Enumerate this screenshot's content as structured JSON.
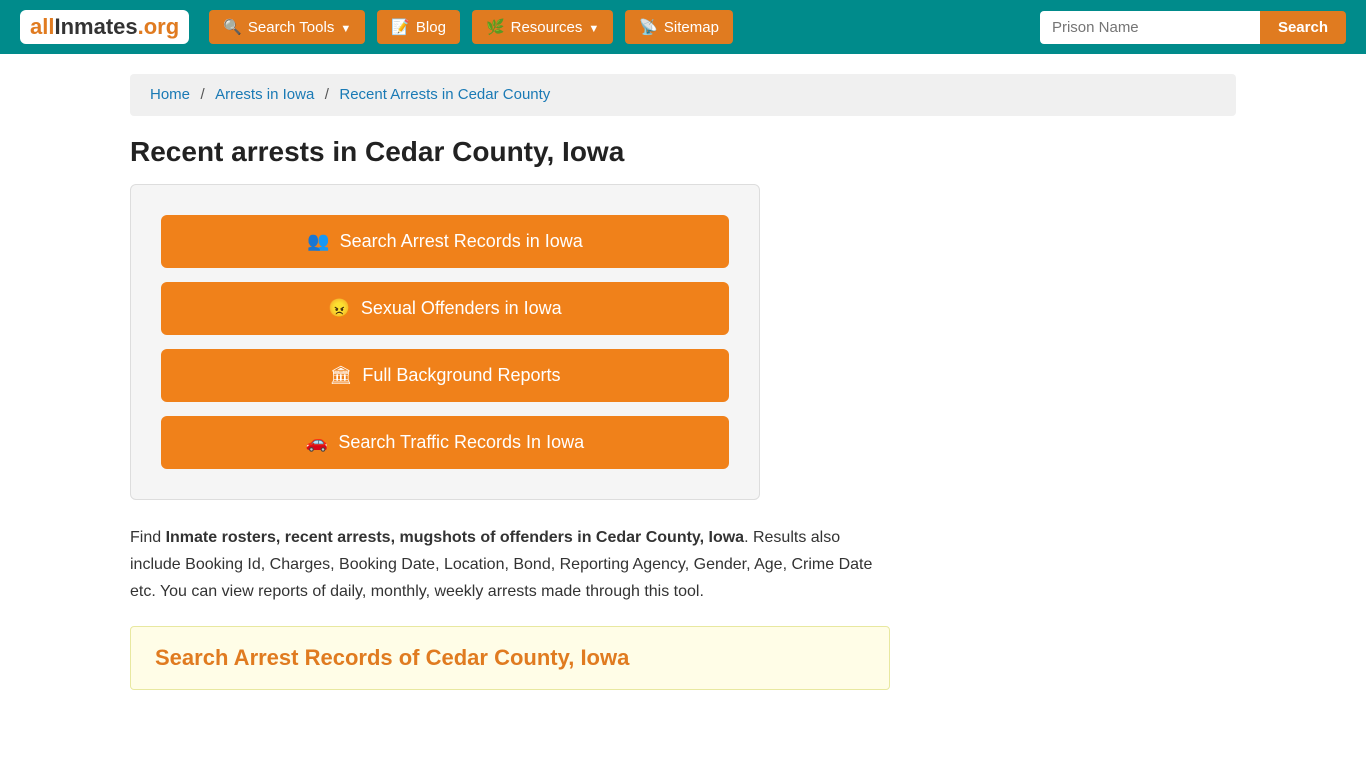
{
  "header": {
    "logo_all": "all",
    "logo_inmates": "Inmates",
    "logo_org": ".org",
    "nav": [
      {
        "id": "search-tools",
        "label": "Search Tools",
        "icon": "🔍",
        "dropdown": true
      },
      {
        "id": "blog",
        "label": "Blog",
        "icon": "📝",
        "dropdown": false
      },
      {
        "id": "resources",
        "label": "Resources",
        "icon": "🌿",
        "dropdown": true
      },
      {
        "id": "sitemap",
        "label": "Sitemap",
        "icon": "📡",
        "dropdown": false
      }
    ],
    "search_placeholder": "Prison Name",
    "search_button_label": "Search"
  },
  "breadcrumb": {
    "items": [
      {
        "label": "Home",
        "href": "#"
      },
      {
        "label": "Arrests in Iowa",
        "href": "#"
      },
      {
        "label": "Recent Arrests in Cedar County",
        "href": "#"
      }
    ]
  },
  "main": {
    "page_title": "Recent arrests in Cedar County, Iowa",
    "action_buttons": [
      {
        "id": "arrest-records",
        "icon": "👥",
        "label": "Search Arrest Records in Iowa"
      },
      {
        "id": "sexual-offenders",
        "icon": "😠",
        "label": "Sexual Offenders in Iowa"
      },
      {
        "id": "background-reports",
        "icon": "🏛",
        "label": "Full Background Reports"
      },
      {
        "id": "traffic-records",
        "icon": "🚗",
        "label": "Search Traffic Records In Iowa"
      }
    ],
    "description_intro": "Find ",
    "description_bold": "Inmate rosters, recent arrests, mugshots of offenders in Cedar County, Iowa",
    "description_rest": ". Results also include Booking Id, Charges, Booking Date, Location, Bond, Reporting Agency, Gender, Age, Crime Date etc. You can view reports of daily, monthly, weekly arrests made through this tool.",
    "search_section_title": "Search Arrest Records of Cedar County, Iowa"
  }
}
